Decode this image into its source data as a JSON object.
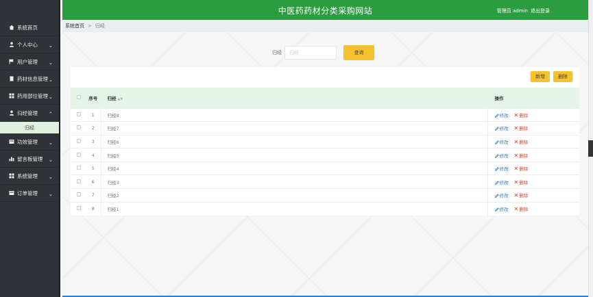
{
  "header": {
    "title": "中医药药材分类采购网站",
    "user_label": "管理员 admin",
    "logout_label": "退出登录"
  },
  "breadcrumb": {
    "home": "系统首页",
    "sep": ">",
    "current": "归经"
  },
  "sidebar": {
    "items": [
      {
        "label": "系统首页",
        "icon": "home-icon",
        "chev": ""
      },
      {
        "label": "个人中心",
        "icon": "user-icon",
        "chev": "⌄"
      },
      {
        "label": "用户管理",
        "icon": "flag-icon",
        "chev": "⌄"
      },
      {
        "label": "药材信息管理",
        "icon": "file-icon",
        "chev": "⌄"
      },
      {
        "label": "药用部位管理",
        "icon": "grid-icon",
        "chev": "⌄"
      },
      {
        "label": "归经管理",
        "icon": "user-icon",
        "chev": "⌃"
      },
      {
        "label": "功效管理",
        "icon": "card-icon",
        "chev": "⌄"
      },
      {
        "label": "留言板管理",
        "icon": "chart-icon",
        "chev": "⌄"
      },
      {
        "label": "系统管理",
        "icon": "grid-icon",
        "chev": "⌄"
      },
      {
        "label": "订单管理",
        "icon": "card-icon",
        "chev": "⌄"
      }
    ],
    "sub_item": "归经"
  },
  "search": {
    "label": "归经",
    "placeholder": "归经",
    "button": "查询"
  },
  "toolbar": {
    "add": "新增",
    "delete": "删除"
  },
  "table": {
    "headers": {
      "index": "序号",
      "name": "归经",
      "ops": "操作"
    },
    "rows": [
      {
        "index": "1",
        "name": "归经8"
      },
      {
        "index": "2",
        "name": "归经7"
      },
      {
        "index": "3",
        "name": "归经6"
      },
      {
        "index": "4",
        "name": "归经5"
      },
      {
        "index": "5",
        "name": "归经4"
      },
      {
        "index": "6",
        "name": "归经3"
      },
      {
        "index": "7",
        "name": "归经2"
      },
      {
        "index": "8",
        "name": "归经1"
      }
    ],
    "edit_label": "修改",
    "delete_label": "删除"
  },
  "colors": {
    "accent": "#2c9d3f",
    "sidebar": "#2f3237",
    "button": "#f5c22f"
  }
}
